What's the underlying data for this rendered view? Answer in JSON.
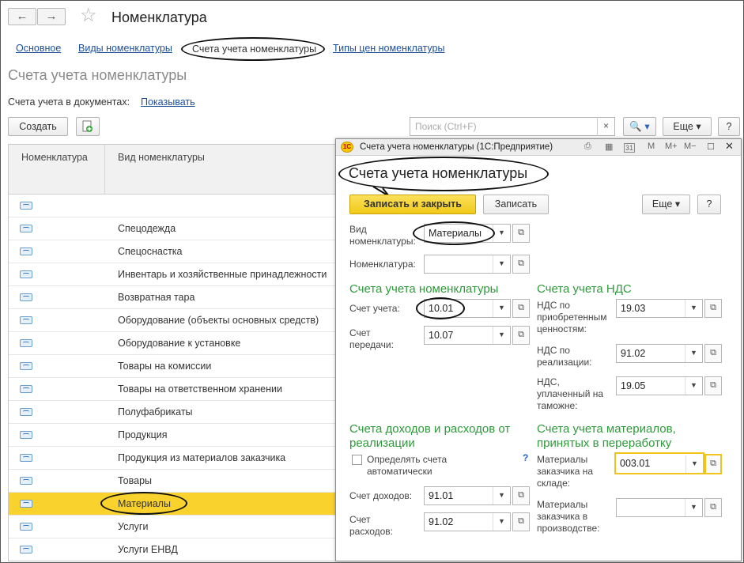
{
  "header": {
    "back": "←",
    "forward": "→",
    "star": "☆",
    "title": "Номенклатура"
  },
  "tabs": [
    {
      "label": "Основное"
    },
    {
      "label": "Виды номенклатуры"
    },
    {
      "label": "Счета учета номенклатуры"
    },
    {
      "label": "Типы цен номенклатуры"
    }
  ],
  "section_title": "Счета учета номенклатуры",
  "accounts_in_docs": {
    "label": "Счета учета в документах:",
    "link": "Показывать"
  },
  "toolbar": {
    "create": "Создать",
    "search_placeholder": "Поиск (Ctrl+F)",
    "clear": "×",
    "search_btn": "🔍 ▾",
    "more": "Еще ▾",
    "help": "?"
  },
  "table": {
    "columns": [
      "Номенклатура",
      "Вид номенклатуры"
    ],
    "rows": [
      {
        "kind": ""
      },
      {
        "kind": "Спецодежда"
      },
      {
        "kind": "Спецоснастка"
      },
      {
        "kind": "Инвентарь и хозяйственные принадлежности"
      },
      {
        "kind": "Возвратная тара"
      },
      {
        "kind": "Оборудование (объекты основных средств)"
      },
      {
        "kind": "Оборудование к установке"
      },
      {
        "kind": "Товары на комиссии"
      },
      {
        "kind": "Товары на ответственном хранении"
      },
      {
        "kind": "Полуфабрикаты"
      },
      {
        "kind": "Продукция"
      },
      {
        "kind": "Продукция из материалов заказчика"
      },
      {
        "kind": "Товары"
      },
      {
        "kind": "Материалы",
        "selected": true
      },
      {
        "kind": "Услуги"
      },
      {
        "kind": "Услуги ЕНВД"
      }
    ]
  },
  "dialog": {
    "window_title": "Счета учета номенклатуры  (1С:Предприятие)",
    "logo": "1С",
    "toolbar_icons": [
      "print-icon",
      "calc-icon",
      "calendar-icon",
      "M",
      "M+",
      "M−",
      "□",
      "✕"
    ],
    "heading": "Счета учета номенклатуры",
    "save_close": "Записать и закрыть",
    "save": "Записать",
    "more": "Еще ▾",
    "help": "?",
    "kind_label": "Вид номенклатуры:",
    "kind_value": "Материалы",
    "item_label": "Номенклатура:",
    "item_value": "",
    "sec_accounts": "Счета учета номенклатуры",
    "account_label": "Счет учета:",
    "account_value": "10.01",
    "transfer_label": "Счет передачи:",
    "transfer_value": "10.07",
    "sec_vat": "Счета учета НДС",
    "vat_acq_label": "НДС по приобретенным ценностям:",
    "vat_acq_value": "19.03",
    "vat_sale_label": "НДС по реализации:",
    "vat_sale_value": "91.02",
    "vat_customs_label": "НДС, уплаченный на таможне:",
    "vat_customs_value": "19.05",
    "sec_income": "Счета доходов и расходов от реализации",
    "auto_label": "Определять счета автоматически",
    "auto_help": "?",
    "income_label": "Счет доходов:",
    "income_value": "91.01",
    "expense_label": "Счет расходов:",
    "expense_value": "91.02",
    "sec_materials": "Счета учета материалов, принятых в переработку",
    "mat_stock_label": "Материалы заказчика на складе:",
    "mat_stock_value": "003.01",
    "mat_prod_label": "Материалы заказчика в производстве:",
    "mat_prod_value": ""
  }
}
